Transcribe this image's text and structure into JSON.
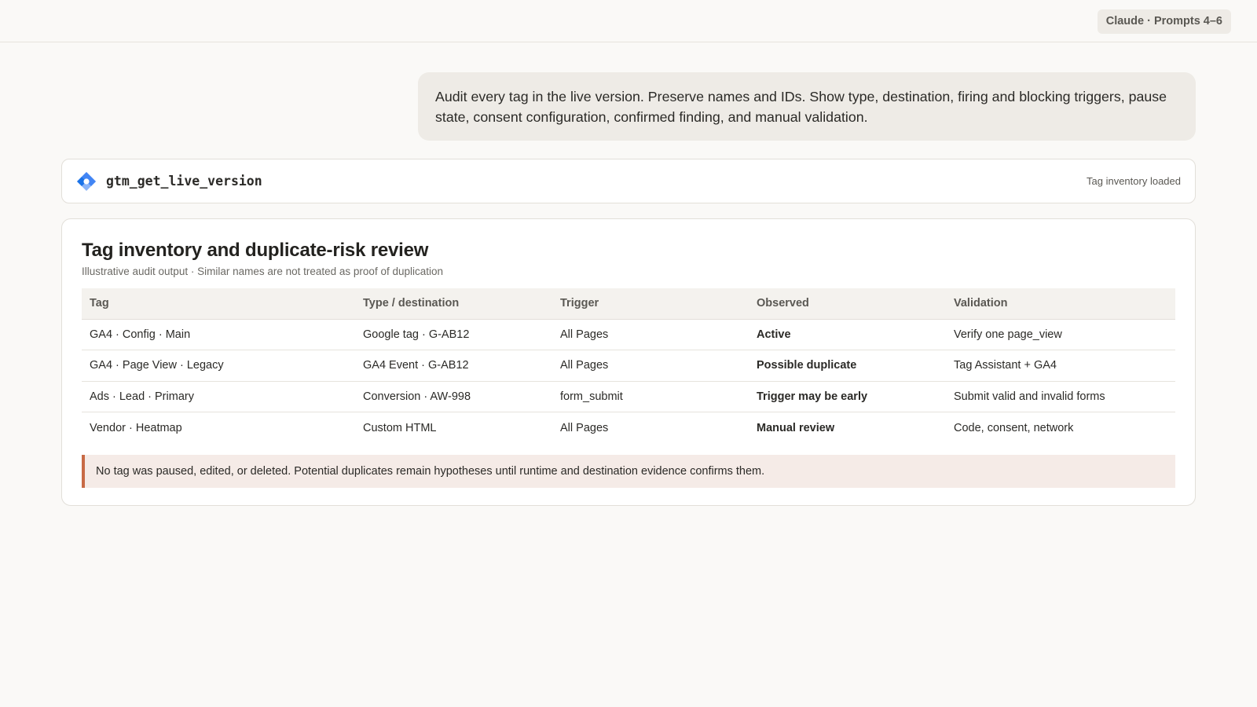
{
  "header": {
    "badge": "Claude · Prompts 4–6"
  },
  "prompt": {
    "text": "Audit every tag in the live version. Preserve names and IDs. Show type, destination, firing and blocking triggers, pause state, consent configuration, confirmed finding, and manual validation."
  },
  "tool": {
    "name": "gtm_get_live_version",
    "status": "Tag inventory loaded",
    "icon": "gtm-diamond-icon",
    "icon_colors": [
      "#8ab4f8",
      "#4285f4",
      "#1a73e8"
    ]
  },
  "review": {
    "title": "Tag inventory and duplicate-risk review",
    "subtitle": "Illustrative audit output · Similar names are not treated as proof of duplication",
    "columns": [
      "Tag",
      "Type / destination",
      "Trigger",
      "Observed",
      "Validation"
    ],
    "rows": [
      {
        "tag": "GA4 · Config · Main",
        "type": "Google tag · G-AB12",
        "trigger": "All Pages",
        "observed": "Active",
        "status": "ok",
        "validation": "Verify one page_view"
      },
      {
        "tag": "GA4 · Page View · Legacy",
        "type": "GA4 Event · G-AB12",
        "trigger": "All Pages",
        "observed": "Possible duplicate",
        "status": "warn",
        "validation": "Tag Assistant + GA4"
      },
      {
        "tag": "Ads · Lead · Primary",
        "type": "Conversion · AW-998",
        "trigger": "form_submit",
        "observed": "Trigger may be early",
        "status": "warn",
        "validation": "Submit valid and invalid forms"
      },
      {
        "tag": "Vendor · Heatmap",
        "type": "Custom HTML",
        "trigger": "All Pages",
        "observed": "Manual review",
        "status": "warn",
        "validation": "Code, consent, network"
      }
    ],
    "notice": "No tag was paused, edited, or deleted. Potential duplicates remain hypotheses until runtime and destination evidence confirms them.",
    "colors": {
      "ok": "#1e7a52",
      "warn": "#b1582b",
      "notice_accent": "#c86a45"
    }
  }
}
